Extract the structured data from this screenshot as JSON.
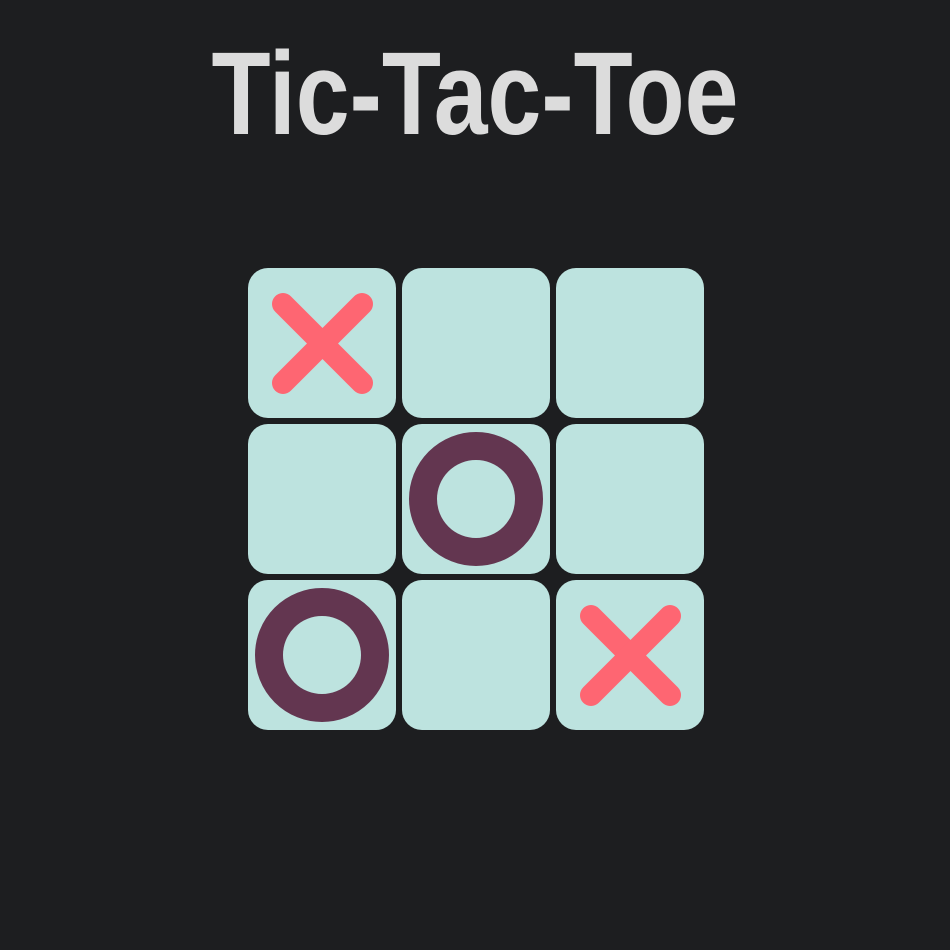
{
  "title": "Tic-Tac-Toe",
  "colors": {
    "background": "#1d1e20",
    "title": "#dcdcdc",
    "cell": "#bde3df",
    "x_mark": "#fe6672",
    "o_mark": "#633650"
  },
  "board": {
    "cells": [
      "X",
      "",
      "",
      "",
      "O",
      "",
      "O",
      "",
      "X"
    ]
  }
}
